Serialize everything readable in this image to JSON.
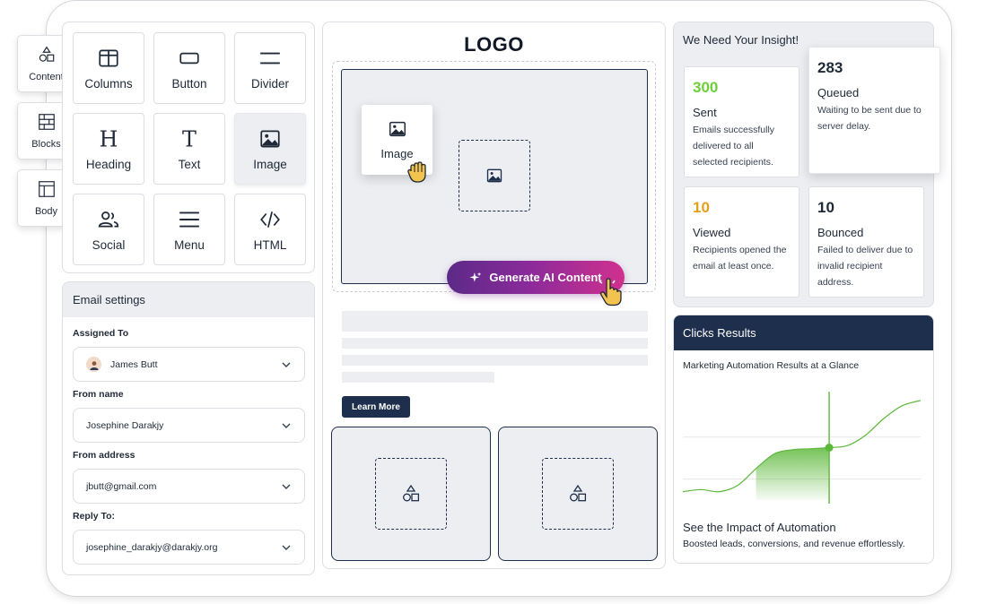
{
  "rail": {
    "tabs": [
      {
        "label": "Content",
        "icon": "shapes-icon"
      },
      {
        "label": "Blocks",
        "icon": "blocks-icon"
      },
      {
        "label": "Body",
        "icon": "body-layout-icon"
      }
    ]
  },
  "blocks": {
    "items": [
      {
        "label": "Columns",
        "icon": "columns-icon"
      },
      {
        "label": "Button",
        "icon": "button-icon"
      },
      {
        "label": "Divider",
        "icon": "divider-icon"
      },
      {
        "label": "Heading",
        "icon": "heading-icon"
      },
      {
        "label": "Text",
        "icon": "text-icon"
      },
      {
        "label": "Image",
        "icon": "image-icon",
        "active": true
      },
      {
        "label": "Social",
        "icon": "social-icon"
      },
      {
        "label": "Menu",
        "icon": "menu-icon"
      },
      {
        "label": "HTML",
        "icon": "code-icon"
      }
    ]
  },
  "settings": {
    "title": "Email settings",
    "assigned_to": {
      "label": "Assigned To",
      "value": "James Butt"
    },
    "from_name": {
      "label": "From name",
      "value": "Josephine Darakjy"
    },
    "from_address": {
      "label": "From address",
      "value": "jbutt@gmail.com"
    },
    "reply_to": {
      "label": "Reply To:",
      "value": "josephine_darakjy@darakjy.org"
    }
  },
  "canvas": {
    "logo": "LOGO",
    "drag_card_label": "Image",
    "ai_button": "Generate AI Content",
    "learn_more": "Learn More"
  },
  "insight": {
    "title": "We Need Your Insight!",
    "stats": [
      {
        "number": "300",
        "name": "Sent",
        "desc": "Emails successfully delivered to all selected recipients.",
        "color": "#6ccf3a"
      },
      {
        "number": "283",
        "name": "Queued",
        "desc": "Waiting to be sent due to server delay.",
        "color": "#1f2937"
      },
      {
        "number": "10",
        "name": "Viewed",
        "desc": "Recipients opened the email at least once.",
        "color": "#e3a11b"
      },
      {
        "number": "10",
        "name": "Bounced",
        "desc": "Failed to deliver due to invalid recipient address.",
        "color": "#1f2937"
      }
    ]
  },
  "clicks": {
    "title": "Clicks Results",
    "subtitle": "Marketing Automation Results at a Glance",
    "impact_title": "See the Impact of Automation",
    "impact_desc": "Boosted leads, conversions, and revenue effortlessly."
  },
  "colors": {
    "navy": "#1e2f4d",
    "green": "#5cb83a",
    "ai_gradient_start": "#5b2a86",
    "ai_gradient_end": "#d0318e"
  },
  "chart_data": {
    "type": "area",
    "series": [
      {
        "values": [
          0.08,
          0.1,
          0.08,
          0.14,
          0.3,
          0.44,
          0.48,
          0.49,
          0.5,
          0.52,
          0.62,
          0.78,
          0.9,
          0.95
        ]
      }
    ],
    "highlight_index": 8,
    "shaded_range": [
      4,
      8
    ],
    "grid": true
  }
}
